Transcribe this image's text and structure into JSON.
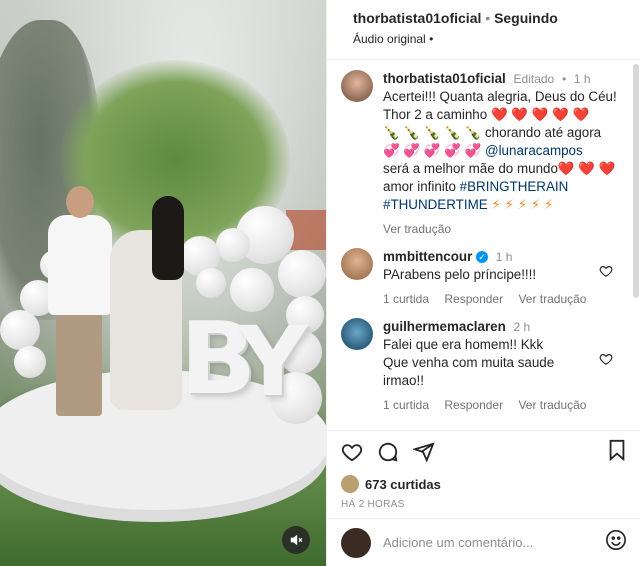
{
  "post": {
    "username": "thorbatista01oficial",
    "follow_status": "Seguindo",
    "audio": "Áudio original",
    "more": "•"
  },
  "caption": {
    "username": "thorbatista01oficial",
    "edited": "Editado",
    "time": "1 h",
    "line1": "Acertei!!! Quanta alegria, Deus do Céu!",
    "line2_text": "Thor 2 a caminho",
    "line2_emoji": "❤️ ❤️ ❤️ ❤️ ❤️",
    "line3_emoji": "🍾 🍾 🍾 🍾 🍾",
    "line3_text": "chorando até agora",
    "line4_emoji": "💞 💞 💞 💞 💞",
    "line4_mention": "@lunaracampos",
    "line5_text": "será a melhor mãe do mundo",
    "line5_emoji": "❤️ ❤️ ❤️",
    "line6_text": "amor infinito",
    "line6_tag": "#BRINGTHERAIN",
    "line7_tag": "#THUNDERTIME",
    "line7_emoji": "⚡ ⚡ ⚡ ⚡ ⚡",
    "translate": "Ver tradução"
  },
  "comments": [
    {
      "username": "mmbittencour",
      "verified_mark": "✓",
      "time": "1 h",
      "text": "PArabens pelo príncipe!!!!",
      "likes": "1 curtida",
      "reply": "Responder",
      "translate": "Ver tradução"
    },
    {
      "username": "guilhermemaclaren",
      "time": "2 h",
      "text_line1": "Falei que era homem!! Kkk",
      "text_line2": "Que venha com muita saude",
      "text_line3": "irmao!!",
      "likes": "1 curtida",
      "reply": "Responder",
      "translate": "Ver tradução"
    }
  ],
  "actions": {
    "like_icon": "heart-icon",
    "comment_icon": "comment-icon",
    "share_icon": "send-icon",
    "save_icon": "bookmark-icon"
  },
  "likes": {
    "count": "673 curtidas"
  },
  "timestamp": "HÁ 2 HORAS",
  "add_comment": {
    "placeholder": "Adicione um comentário..."
  },
  "video_letters": [
    "B",
    "Y"
  ],
  "colors": {
    "link": "#00376b",
    "muted": "#8e8e8e",
    "verified": "#0095f6"
  }
}
